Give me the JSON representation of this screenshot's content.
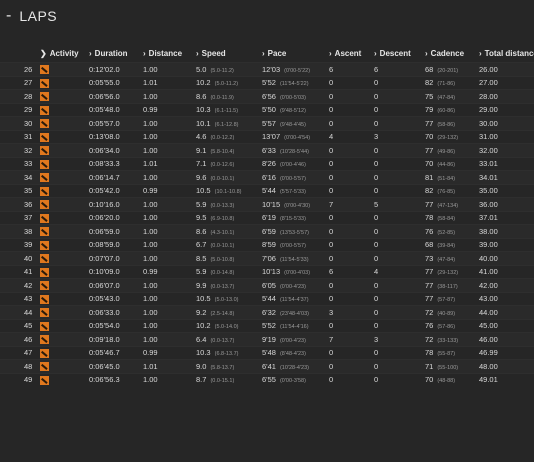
{
  "header": {
    "dash": "-",
    "title": "LAPS"
  },
  "columns": {
    "activity": "Activity",
    "duration": "Duration",
    "distance": "Distance",
    "speed": "Speed",
    "pace": "Pace",
    "ascent": "Ascent",
    "descent": "Descent",
    "cadence": "Cadence",
    "total_distance": "Total distance"
  },
  "activity_icon": "running-activity-icon",
  "accent_color": "#e0781e",
  "laps": [
    {
      "lap": "26",
      "duration": "0:12'02.0",
      "distance": "1.00",
      "speed": "5.0",
      "speed_range": "(5.0-11.2)",
      "pace": "12'03",
      "pace_range": "(0'00-5'22)",
      "ascent": "6",
      "descent": "6",
      "cadence": "68",
      "cadence_range": "(20-201)",
      "total": "26.00"
    },
    {
      "lap": "27",
      "duration": "0:05'55.0",
      "distance": "1.01",
      "speed": "10.2",
      "speed_range": "(5.0-11.2)",
      "pace": "5'52",
      "pace_range": "(11'54-5'22)",
      "ascent": "0",
      "descent": "0",
      "cadence": "82",
      "cadence_range": "(71-86)",
      "total": "27.00"
    },
    {
      "lap": "28",
      "duration": "0:06'56.0",
      "distance": "1.00",
      "speed": "8.6",
      "speed_range": "(0.0-11.9)",
      "pace": "6'56",
      "pace_range": "(0'00-5'03)",
      "ascent": "0",
      "descent": "0",
      "cadence": "75",
      "cadence_range": "(47-84)",
      "total": "28.00"
    },
    {
      "lap": "29",
      "duration": "0:05'48.0",
      "distance": "0.99",
      "speed": "10.3",
      "speed_range": "(6.1-11.5)",
      "pace": "5'50",
      "pace_range": "(9'48-5'12)",
      "ascent": "0",
      "descent": "0",
      "cadence": "79",
      "cadence_range": "(60-86)",
      "total": "29.00"
    },
    {
      "lap": "30",
      "duration": "0:05'57.0",
      "distance": "1.00",
      "speed": "10.1",
      "speed_range": "(6.1-12.8)",
      "pace": "5'57",
      "pace_range": "(9'48-4'45)",
      "ascent": "0",
      "descent": "0",
      "cadence": "77",
      "cadence_range": "(58-86)",
      "total": "30.00"
    },
    {
      "lap": "31",
      "duration": "0:13'08.0",
      "distance": "1.00",
      "speed": "4.6",
      "speed_range": "(0.0-12.2)",
      "pace": "13'07",
      "pace_range": "(0'00-4'54)",
      "ascent": "4",
      "descent": "3",
      "cadence": "70",
      "cadence_range": "(29-132)",
      "total": "31.00"
    },
    {
      "lap": "32",
      "duration": "0:06'34.0",
      "distance": "1.00",
      "speed": "9.1",
      "speed_range": "(5.8-10.4)",
      "pace": "6'33",
      "pace_range": "(10'28-5'44)",
      "ascent": "0",
      "descent": "0",
      "cadence": "77",
      "cadence_range": "(49-86)",
      "total": "32.00"
    },
    {
      "lap": "33",
      "duration": "0:08'33.3",
      "distance": "1.01",
      "speed": "7.1",
      "speed_range": "(0.0-12.6)",
      "pace": "8'26",
      "pace_range": "(0'00-4'46)",
      "ascent": "0",
      "descent": "0",
      "cadence": "70",
      "cadence_range": "(44-86)",
      "total": "33.01"
    },
    {
      "lap": "34",
      "duration": "0:06'14.7",
      "distance": "1.00",
      "speed": "9.6",
      "speed_range": "(0.0-10.1)",
      "pace": "6'16",
      "pace_range": "(0'00-5'57)",
      "ascent": "0",
      "descent": "0",
      "cadence": "81",
      "cadence_range": "(51-84)",
      "total": "34.01"
    },
    {
      "lap": "35",
      "duration": "0:05'42.0",
      "distance": "0.99",
      "speed": "10.5",
      "speed_range": "(10.1-10.8)",
      "pace": "5'44",
      "pace_range": "(5'57-5'33)",
      "ascent": "0",
      "descent": "0",
      "cadence": "82",
      "cadence_range": "(76-85)",
      "total": "35.00"
    },
    {
      "lap": "36",
      "duration": "0:10'16.0",
      "distance": "1.00",
      "speed": "5.9",
      "speed_range": "(0.0-13.3)",
      "pace": "10'15",
      "pace_range": "(0'00-4'30)",
      "ascent": "7",
      "descent": "5",
      "cadence": "77",
      "cadence_range": "(47-134)",
      "total": "36.00"
    },
    {
      "lap": "37",
      "duration": "0:06'20.0",
      "distance": "1.00",
      "speed": "9.5",
      "speed_range": "(6.9-10.8)",
      "pace": "6'19",
      "pace_range": "(8'15-5'33)",
      "ascent": "0",
      "descent": "0",
      "cadence": "78",
      "cadence_range": "(58-84)",
      "total": "37.01"
    },
    {
      "lap": "38",
      "duration": "0:06'59.0",
      "distance": "1.00",
      "speed": "8.6",
      "speed_range": "(4.3-10.1)",
      "pace": "6'59",
      "pace_range": "(13'53-5'57)",
      "ascent": "0",
      "descent": "0",
      "cadence": "76",
      "cadence_range": "(52-85)",
      "total": "38.00"
    },
    {
      "lap": "39",
      "duration": "0:08'59.0",
      "distance": "1.00",
      "speed": "6.7",
      "speed_range": "(0.0-10.1)",
      "pace": "8'59",
      "pace_range": "(0'00-5'57)",
      "ascent": "0",
      "descent": "0",
      "cadence": "68",
      "cadence_range": "(39-84)",
      "total": "39.00"
    },
    {
      "lap": "40",
      "duration": "0:07'07.0",
      "distance": "1.00",
      "speed": "8.5",
      "speed_range": "(5.0-10.8)",
      "pace": "7'06",
      "pace_range": "(11'54-5'33)",
      "ascent": "0",
      "descent": "0",
      "cadence": "73",
      "cadence_range": "(47-84)",
      "total": "40.00"
    },
    {
      "lap": "41",
      "duration": "0:10'09.0",
      "distance": "0.99",
      "speed": "5.9",
      "speed_range": "(0.0-14.8)",
      "pace": "10'13",
      "pace_range": "(0'00-4'03)",
      "ascent": "6",
      "descent": "4",
      "cadence": "77",
      "cadence_range": "(29-132)",
      "total": "41.00"
    },
    {
      "lap": "42",
      "duration": "0:06'07.0",
      "distance": "1.00",
      "speed": "9.9",
      "speed_range": "(0.0-13.7)",
      "pace": "6'05",
      "pace_range": "(0'00-4'23)",
      "ascent": "0",
      "descent": "0",
      "cadence": "77",
      "cadence_range": "(38-117)",
      "total": "42.00"
    },
    {
      "lap": "43",
      "duration": "0:05'43.0",
      "distance": "1.00",
      "speed": "10.5",
      "speed_range": "(5.0-13.0)",
      "pace": "5'44",
      "pace_range": "(11'54-4'37)",
      "ascent": "0",
      "descent": "0",
      "cadence": "77",
      "cadence_range": "(57-87)",
      "total": "43.00"
    },
    {
      "lap": "44",
      "duration": "0:06'33.0",
      "distance": "1.00",
      "speed": "9.2",
      "speed_range": "(2.5-14.8)",
      "pace": "6'32",
      "pace_range": "(23'48-4'03)",
      "ascent": "3",
      "descent": "0",
      "cadence": "72",
      "cadence_range": "(40-89)",
      "total": "44.00"
    },
    {
      "lap": "45",
      "duration": "0:05'54.0",
      "distance": "1.00",
      "speed": "10.2",
      "speed_range": "(5.0-14.0)",
      "pace": "5'52",
      "pace_range": "(11'54-4'16)",
      "ascent": "0",
      "descent": "0",
      "cadence": "76",
      "cadence_range": "(57-86)",
      "total": "45.00"
    },
    {
      "lap": "46",
      "duration": "0:09'18.0",
      "distance": "1.00",
      "speed": "6.4",
      "speed_range": "(0.0-13.7)",
      "pace": "9'19",
      "pace_range": "(0'00-4'23)",
      "ascent": "7",
      "descent": "3",
      "cadence": "72",
      "cadence_range": "(33-133)",
      "total": "46.00"
    },
    {
      "lap": "47",
      "duration": "0:05'46.7",
      "distance": "0.99",
      "speed": "10.3",
      "speed_range": "(6.8-13.7)",
      "pace": "5'48",
      "pace_range": "(8'48-4'23)",
      "ascent": "0",
      "descent": "0",
      "cadence": "78",
      "cadence_range": "(55-87)",
      "total": "46.99"
    },
    {
      "lap": "48",
      "duration": "0:06'45.0",
      "distance": "1.01",
      "speed": "9.0",
      "speed_range": "(5.8-13.7)",
      "pace": "6'41",
      "pace_range": "(10'28-4'23)",
      "ascent": "0",
      "descent": "0",
      "cadence": "71",
      "cadence_range": "(55-100)",
      "total": "48.00"
    },
    {
      "lap": "49",
      "duration": "0:06'56.3",
      "distance": "1.00",
      "speed": "8.7",
      "speed_range": "(0.0-15.1)",
      "pace": "6'55",
      "pace_range": "(0'00-3'58)",
      "ascent": "0",
      "descent": "0",
      "cadence": "70",
      "cadence_range": "(48-88)",
      "total": "49.01"
    }
  ]
}
